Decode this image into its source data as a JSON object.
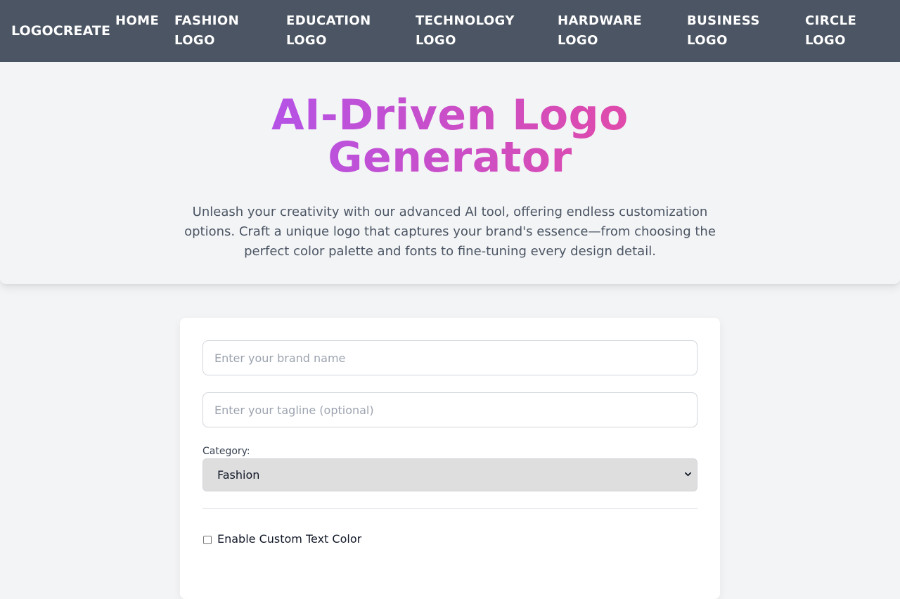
{
  "nav": {
    "brand": "LOGOCREATE",
    "items": [
      {
        "label": "HOME"
      },
      {
        "label": "FASHION LOGO"
      },
      {
        "label": "EDUCATION LOGO"
      },
      {
        "label": "TECHNOLOGY LOGO"
      },
      {
        "label": "HARDWARE LOGO"
      },
      {
        "label": "BUSINESS LOGO"
      },
      {
        "label": "CIRCLE LOGO"
      }
    ]
  },
  "hero": {
    "title": "AI-Driven Logo Generator",
    "description": "Unleash your creativity with our advanced AI tool, offering endless customization options. Craft a unique logo that captures your brand's essence—from choosing the perfect color palette and fonts to fine-tuning every design detail."
  },
  "form": {
    "brand_placeholder": "Enter your brand name",
    "brand_value": "",
    "tagline_placeholder": "Enter your tagline (optional)",
    "tagline_value": "",
    "category_label": "Category:",
    "category_selected": "Fashion",
    "custom_color_label": "Enable Custom Text Color",
    "custom_color_checked": false
  },
  "colors": {
    "navbar": "#4b5563",
    "gradient_start": "#a855f7",
    "gradient_end": "#ec4899",
    "page_background": "#f3f4f6"
  },
  "icons": {
    "category_dropdown": "chevron-down-icon"
  }
}
